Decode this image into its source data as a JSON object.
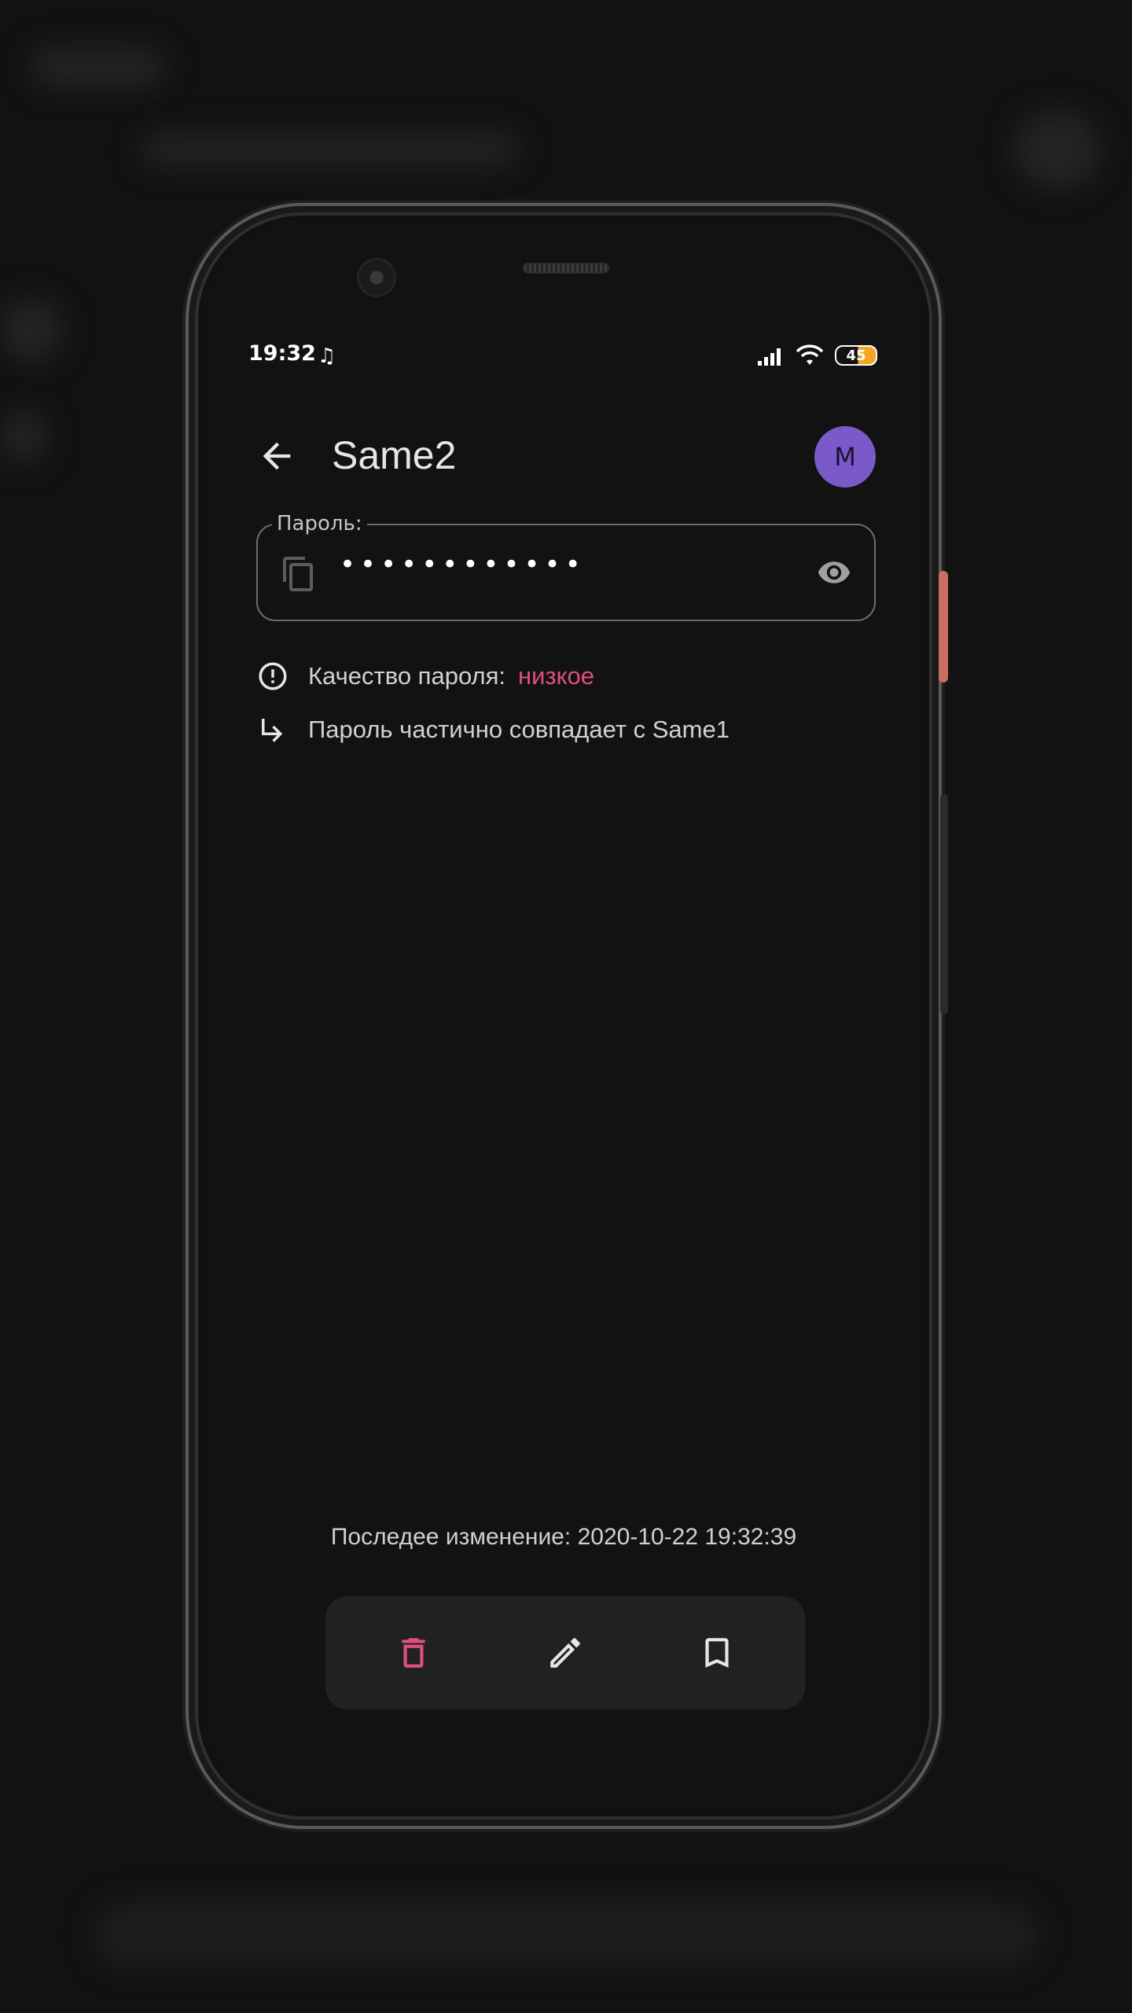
{
  "status_bar": {
    "time": "19:32",
    "battery": "45"
  },
  "header": {
    "title": "Same2",
    "avatar_letter": "M"
  },
  "password_field": {
    "label": "Пароль:",
    "value": "••••••••••••"
  },
  "quality": {
    "label": "Качество пароля:",
    "value": "низкое",
    "value_color": "#e0507d"
  },
  "match": {
    "text": "Пароль частично совпадает с Same1"
  },
  "footer": {
    "last_modified": "Последее изменение: 2020-10-22 19:32:39"
  },
  "actions": {
    "delete_icon": "trash-icon",
    "edit_icon": "pencil-icon",
    "bookmark_icon": "bookmark-icon",
    "delete_color": "#e0507d"
  },
  "theme": {
    "background": "#121212",
    "accent_avatar": "#7a5ac8"
  }
}
